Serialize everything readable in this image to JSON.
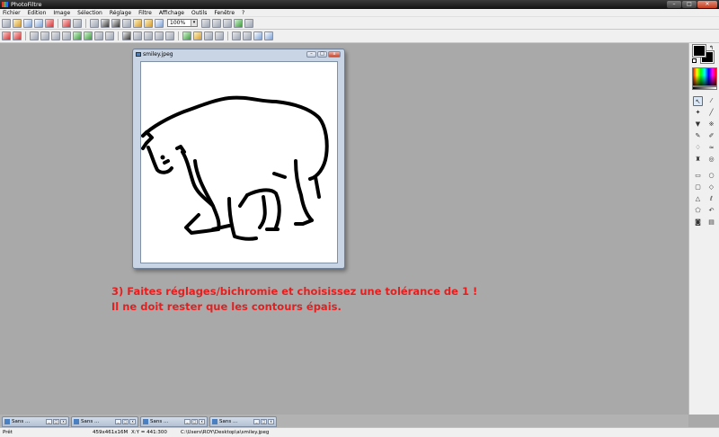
{
  "app": {
    "title": "PhotoFiltre"
  },
  "window_buttons": {
    "minimize": "–",
    "maximize": "□",
    "close": "✕"
  },
  "menu": [
    "Fichier",
    "Edition",
    "Image",
    "Sélection",
    "Réglage",
    "Filtre",
    "Affichage",
    "Outils",
    "Fenêtre",
    "?"
  ],
  "toolbar": {
    "zoom_value": "100%",
    "zoom_arrow": "▾"
  },
  "image_window": {
    "title": "smiley.jpeg",
    "btn_min": "–",
    "btn_max": "□",
    "btn_close": "x"
  },
  "instruction": {
    "line1": "3) Faites réglages/bichromie et choisissez une tolérance de 1 !",
    "line2": "Il ne doit rester que les contours épais."
  },
  "color_panel": {
    "swap_glyph": "↰"
  },
  "tools_panel": {
    "tools": [
      {
        "icon": "pointer-tool-icon",
        "glyph": "↖"
      },
      {
        "icon": "eyedropper-icon",
        "glyph": "⁄"
      },
      {
        "icon": "magic-wand-icon",
        "glyph": "✦"
      },
      {
        "icon": "line-tool-icon",
        "glyph": "╱"
      },
      {
        "icon": "fill-bucket-icon",
        "glyph": "▼"
      },
      {
        "icon": "spray-icon",
        "glyph": "※"
      },
      {
        "icon": "brush-icon",
        "glyph": "✎"
      },
      {
        "icon": "pencil-icon",
        "glyph": "✐"
      },
      {
        "icon": "blur-drop-icon",
        "glyph": "♢"
      },
      {
        "icon": "smudge-icon",
        "glyph": "≈"
      },
      {
        "icon": "stamp-icon",
        "glyph": "♜"
      },
      {
        "icon": "clone-icon",
        "glyph": "◎"
      },
      {
        "icon": "rectangle-select-icon",
        "glyph": "▭"
      },
      {
        "icon": "ellipse-select-icon",
        "glyph": "○"
      },
      {
        "icon": "rounded-rect-icon",
        "glyph": "▢"
      },
      {
        "icon": "diamond-select-icon",
        "glyph": "◇"
      },
      {
        "icon": "triangle-select-icon",
        "glyph": "△"
      },
      {
        "icon": "lasso-icon",
        "glyph": "ℓ"
      },
      {
        "icon": "polygon-select-icon",
        "glyph": "⬠"
      },
      {
        "icon": "undo-arrow-icon",
        "glyph": "↶"
      },
      {
        "icon": "mask-icon",
        "glyph": "◙"
      },
      {
        "icon": "grid-icon",
        "glyph": "▤"
      }
    ]
  },
  "taskbar": [
    {
      "label": "Sans ..."
    },
    {
      "label": "Sans ..."
    },
    {
      "label": "Sans ..."
    },
    {
      "label": "Sans ..."
    }
  ],
  "task_btns": {
    "b1": "_",
    "b2": "□",
    "b3": "x"
  },
  "status": {
    "ready": "Prêt",
    "dimensions": "459x461x16M",
    "coords": "X:Y = 441:300",
    "path": "C:\\Users\\ROY\\Desktop\\a\\smiley.jpeg"
  },
  "colors": {
    "instruction": "#e31f1f",
    "foreground": "#000000",
    "background": "#000000"
  }
}
